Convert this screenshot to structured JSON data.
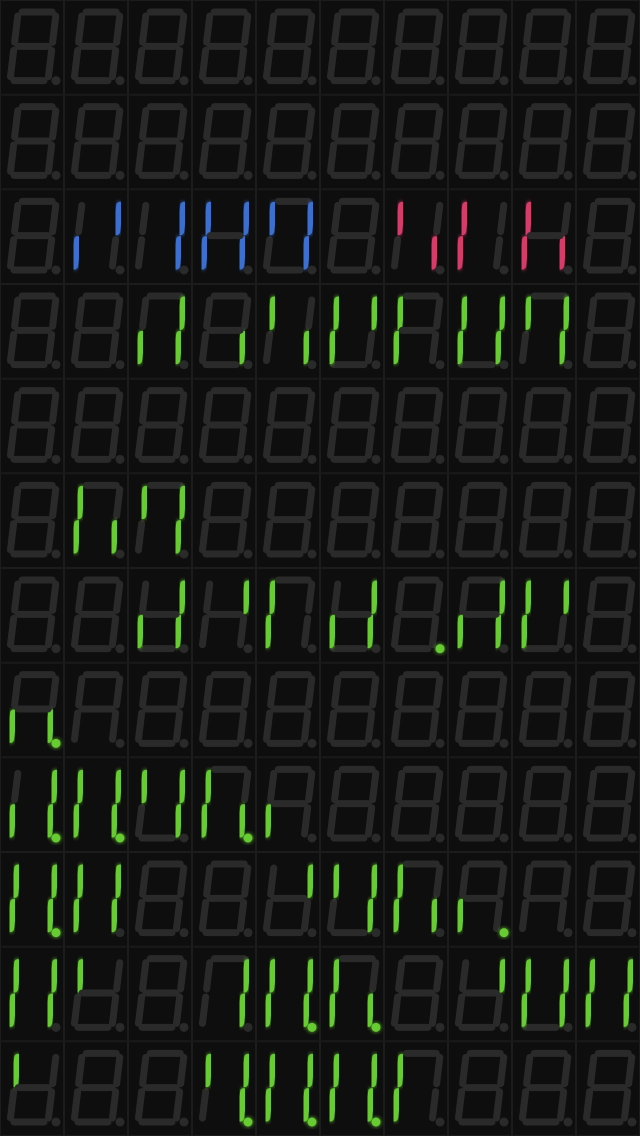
{
  "display": {
    "columns": 10,
    "off_color": "#2a2a2a",
    "default_on_color": "#66cc33",
    "rows": [
      {
        "color": "#66cc33",
        "cells": [
          {
            "segs": "",
            "dp": false
          },
          {
            "segs": "",
            "dp": false
          },
          {
            "segs": "",
            "dp": false
          },
          {
            "segs": "",
            "dp": false
          },
          {
            "segs": "",
            "dp": false
          },
          {
            "segs": "",
            "dp": false
          },
          {
            "segs": "",
            "dp": false
          },
          {
            "segs": "",
            "dp": false
          },
          {
            "segs": "",
            "dp": false
          },
          {
            "segs": "",
            "dp": false
          }
        ]
      },
      {
        "color": "#66cc33",
        "cells": [
          {
            "segs": "",
            "dp": false
          },
          {
            "segs": "",
            "dp": false
          },
          {
            "segs": "",
            "dp": false
          },
          {
            "segs": "",
            "dp": false
          },
          {
            "segs": "",
            "dp": false
          },
          {
            "segs": "",
            "dp": false
          },
          {
            "segs": "",
            "dp": false
          },
          {
            "segs": "",
            "dp": false
          },
          {
            "segs": "",
            "dp": false
          },
          {
            "segs": "",
            "dp": false
          }
        ]
      },
      {
        "color": "#3a6fd1",
        "cells": [
          {
            "segs": "",
            "dp": false
          },
          {
            "char": "2",
            "segs": "abdeg",
            "dp": false
          },
          {
            "char": "3",
            "segs": "abcdg",
            "dp": false
          },
          {
            "char": "0",
            "segs": "abcdef",
            "dp": false
          },
          {
            "char": "4",
            "segs": "bcfg",
            "dp": false
          },
          {
            "segs": "",
            "dp": false
          },
          {
            "char": "S",
            "segs": "acdfg",
            "dp": false,
            "color": "#d63a6a"
          },
          {
            "char": "E",
            "segs": "adefg",
            "dp": false,
            "color": "#d63a6a"
          },
          {
            "char": "G",
            "segs": "acdef",
            "dp": false,
            "color": "#d63a6a"
          },
          {
            "segs": "",
            "dp": false
          }
        ]
      },
      {
        "color": "#66cc33",
        "cells": [
          {
            "segs": "",
            "dp": false
          },
          {
            "segs": "",
            "dp": false
          },
          {
            "char": "d",
            "segs": "bcdeg",
            "dp": false
          },
          {
            "char": "i",
            "segs": "c",
            "dp": false
          },
          {
            "char": "S",
            "segs": "acdfg",
            "dp": false
          },
          {
            "char": "P",
            "segs": "abefg",
            "dp": false
          },
          {
            "char": "L",
            "segs": "def",
            "dp": false
          },
          {
            "char": "A",
            "segs": "abcefg",
            "dp": false
          },
          {
            "char": "Y",
            "segs": "bcdfg",
            "dp": false
          },
          {
            "segs": "",
            "dp": false
          }
        ]
      },
      {
        "color": "#66cc33",
        "cells": [
          {
            "segs": "",
            "dp": false
          },
          {
            "segs": "",
            "dp": false
          },
          {
            "segs": "",
            "dp": false
          },
          {
            "segs": "",
            "dp": false
          },
          {
            "segs": "",
            "dp": false
          },
          {
            "segs": "",
            "dp": false
          },
          {
            "segs": "",
            "dp": false
          },
          {
            "segs": "",
            "dp": false
          },
          {
            "segs": "",
            "dp": false
          },
          {
            "segs": "",
            "dp": false
          }
        ]
      },
      {
        "color": "#66cc33",
        "cells": [
          {
            "segs": "",
            "dp": false
          },
          {
            "char": "b",
            "segs": "cdefg",
            "dp": false
          },
          {
            "char": "y",
            "segs": "bcdfg",
            "dp": false
          },
          {
            "segs": "",
            "dp": false
          },
          {
            "segs": "",
            "dp": false
          },
          {
            "segs": "",
            "dp": false
          },
          {
            "segs": "",
            "dp": false
          },
          {
            "segs": "",
            "dp": false
          },
          {
            "segs": "",
            "dp": false
          },
          {
            "segs": "",
            "dp": false
          }
        ]
      },
      {
        "color": "#66cc33",
        "cells": [
          {
            "segs": "",
            "dp": false
          },
          {
            "segs": "",
            "dp": false
          },
          {
            "char": "n",
            "segs": "abce",
            "dp": false
          },
          {
            "char": "z",
            "segs": "abd",
            "dp": false
          },
          {
            "char": "t",
            "segs": "defg",
            "dp": false
          },
          {
            "char": "n",
            "segs": "abce",
            "dp": false
          },
          {
            "segs": "",
            "dp": true
          },
          {
            "char": "J",
            "segs": "bcde",
            "dp": false
          },
          {
            "char": "P",
            "segs": "abefg",
            "dp": false
          },
          {
            "segs": "",
            "dp": false
          }
        ]
      },
      {
        "color": "#66cc33",
        "cells": [
          {
            "char": "u",
            "segs": "cde",
            "dp": true
          },
          {
            "char": "_",
            "segs": "d",
            "dp": false
          },
          {
            "segs": "",
            "dp": false
          },
          {
            "segs": "",
            "dp": false
          },
          {
            "segs": "",
            "dp": false
          },
          {
            "segs": "",
            "dp": false
          },
          {
            "segs": "",
            "dp": false
          },
          {
            "segs": "",
            "dp": false
          },
          {
            "segs": "",
            "dp": false
          },
          {
            "segs": "",
            "dp": false
          }
        ]
      },
      {
        "color": "#66cc33",
        "cells": [
          {
            "char": "2",
            "segs": "abcdeg",
            "dp": true
          },
          {
            "char": "8",
            "segs": "abcdefg",
            "dp": true
          },
          {
            "char": "9",
            "segs": "abcfg",
            "dp": false
          },
          {
            "char": "b",
            "segs": "cdefg",
            "dp": true
          },
          {
            "char": "L",
            "segs": "de",
            "dp": false
          },
          {
            "segs": "",
            "dp": false
          },
          {
            "segs": "",
            "dp": false
          },
          {
            "segs": "",
            "dp": false
          },
          {
            "segs": "",
            "dp": false
          },
          {
            "segs": "",
            "dp": false
          }
        ]
      },
      {
        "color": "#66cc33",
        "cells": [
          {
            "char": "8",
            "segs": "abcdefg",
            "dp": true
          },
          {
            "char": "8",
            "segs": "abcdefg",
            "dp": false
          },
          {
            "segs": "",
            "dp": false
          },
          {
            "segs": "",
            "dp": false
          },
          {
            "char": "7",
            "segs": "ab",
            "dp": false
          },
          {
            "char": "9",
            "segs": "abcfg",
            "dp": false
          },
          {
            "char": "b",
            "segs": "cdefg",
            "dp": false
          },
          {
            "char": "L",
            "segs": "de",
            "dp": true
          },
          {
            "char": "_",
            "segs": "d",
            "dp": false
          },
          {
            "segs": "",
            "dp": false
          }
        ]
      },
      {
        "color": "#66cc33",
        "cells": [
          {
            "char": "8",
            "segs": "abcdefg",
            "dp": false
          },
          {
            "char": "r",
            "segs": "af",
            "dp": false
          },
          {
            "segs": "",
            "dp": false
          },
          {
            "char": "3",
            "segs": "bcdg",
            "dp": false
          },
          {
            "char": "8",
            "segs": "abcdefg",
            "dp": true
          },
          {
            "char": "b",
            "segs": "cdefg",
            "dp": true
          },
          {
            "segs": "",
            "dp": false
          },
          {
            "char": "7",
            "segs": "ab",
            "dp": false
          },
          {
            "char": "A",
            "segs": "abcefg",
            "dp": false
          },
          {
            "char": "8",
            "segs": "abcdefg",
            "dp": false
          }
        ]
      },
      {
        "color": "#66cc33",
        "cells": [
          {
            "char": "r",
            "segs": "af",
            "dp": false
          },
          {
            "segs": "",
            "dp": false
          },
          {
            "segs": "",
            "dp": false
          },
          {
            "char": "9",
            "segs": "abcdfg",
            "dp": true
          },
          {
            "char": "8",
            "segs": "abcdefg",
            "dp": true
          },
          {
            "char": "8",
            "segs": "abcdefg",
            "dp": true
          },
          {
            "char": "t",
            "segs": "defg",
            "dp": false
          },
          {
            "segs": "",
            "dp": false
          },
          {
            "segs": "",
            "dp": false
          },
          {
            "segs": "",
            "dp": false
          }
        ]
      }
    ]
  }
}
